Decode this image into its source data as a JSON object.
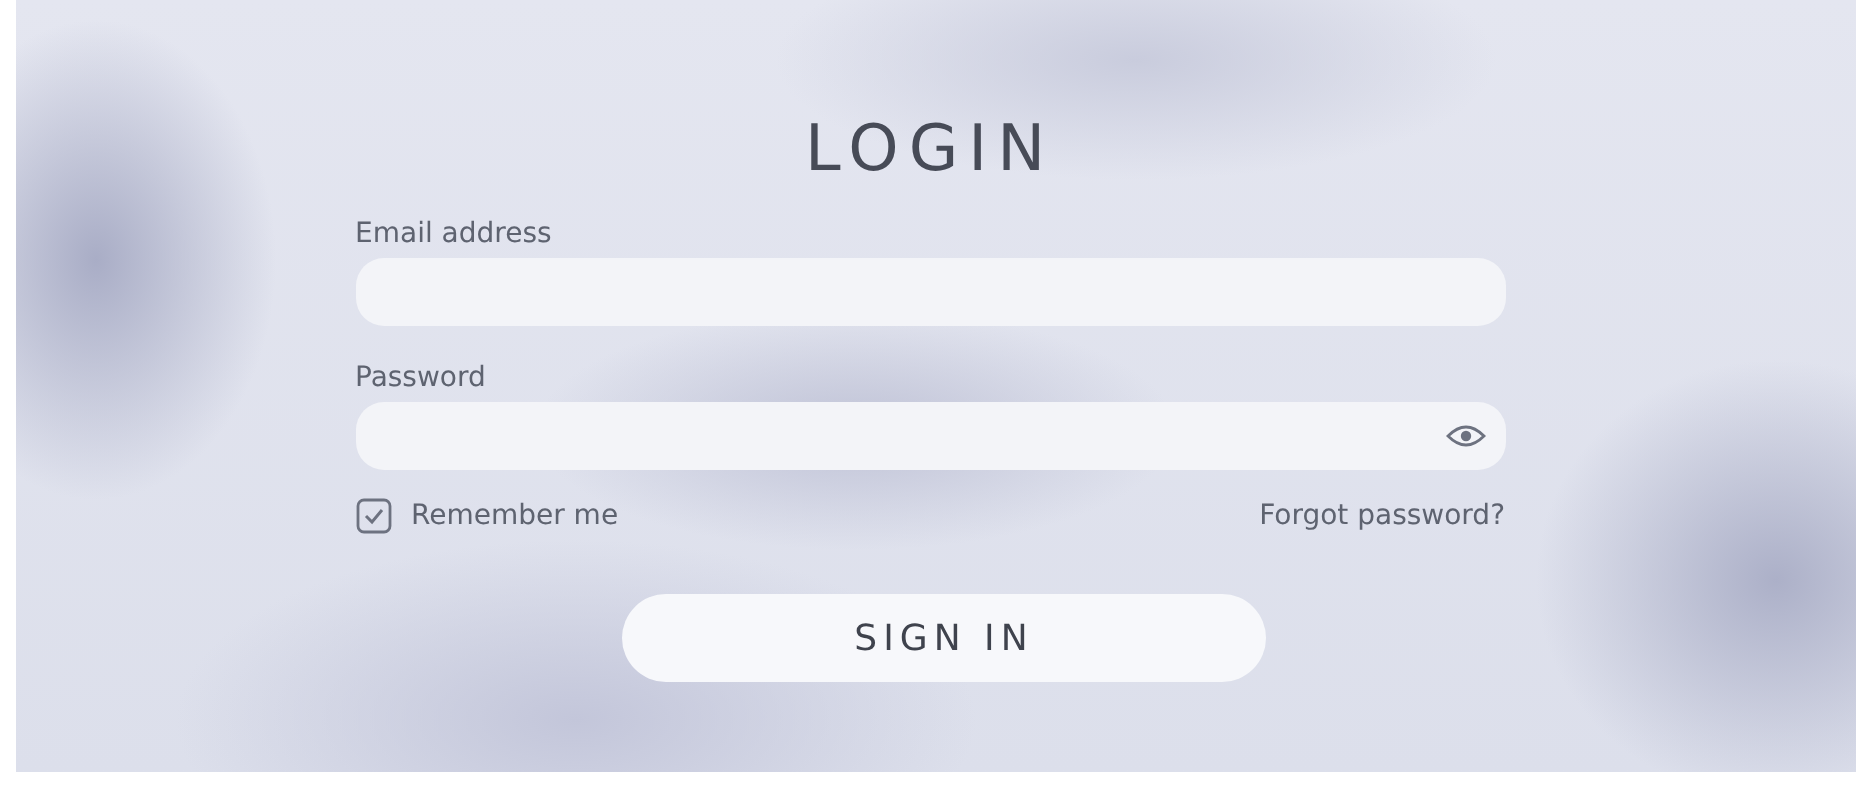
{
  "title": "LOGIN",
  "fields": [
    {
      "label": "Email address",
      "kind": "text"
    },
    {
      "label": "Password",
      "kind": "password"
    }
  ],
  "remember": {
    "label": "Remember me",
    "checked": true
  },
  "forgot_link": "Forgot password?",
  "button": "SIGN IN"
}
